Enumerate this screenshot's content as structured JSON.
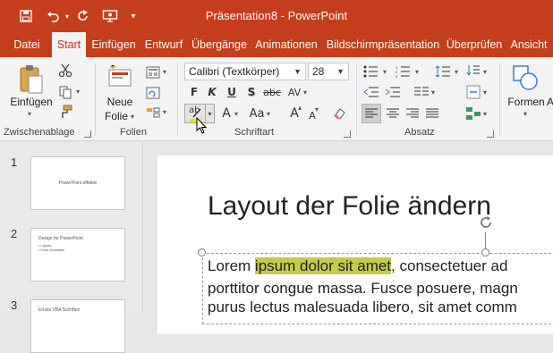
{
  "window": {
    "title": "Präsentation8 - PowerPoint"
  },
  "qat": {
    "save_icon": "save-icon",
    "undo_icon": "undo-icon",
    "redo_icon": "redo-icon",
    "present_icon": "present-from-start-icon",
    "customize_icon": "customize-qat-icon"
  },
  "tabs": [
    {
      "label": "Datei"
    },
    {
      "label": "Start"
    },
    {
      "label": "Einfügen"
    },
    {
      "label": "Entwurf"
    },
    {
      "label": "Übergänge"
    },
    {
      "label": "Animationen"
    },
    {
      "label": "Bildschirmpräsentation"
    },
    {
      "label": "Überprüfen"
    },
    {
      "label": "Ansicht"
    }
  ],
  "active_tab": "Start",
  "ribbon": {
    "clipboard": {
      "label": "Zwischenablage",
      "paste_label": "Einfügen"
    },
    "slides": {
      "label": "Folien",
      "new_slide_line1": "Neue",
      "new_slide_line2": "Folie"
    },
    "font": {
      "label": "Schriftart",
      "font_name": "Calibri (Textkörper)",
      "font_size": "28",
      "bold": "F",
      "italic": "K",
      "underline": "U",
      "shadow": "S",
      "strikethrough": "abc",
      "spacing": "AV",
      "highlight": "ab",
      "font_color": "A",
      "change_case": "Aa",
      "grow": "A",
      "shrink": "A"
    },
    "paragraph": {
      "label": "Absatz"
    },
    "drawing": {
      "label": "Formen",
      "label2": "A"
    }
  },
  "thumbnails": [
    {
      "number": "1",
      "text": "PowerPoint effektiv"
    },
    {
      "number": "2",
      "text_line1": "Design für PowerPoint",
      "text_line2": "• Layout",
      "text_line3": "• Folie einstellen"
    },
    {
      "number": "3",
      "text": "Ernsts VBA Schriften"
    }
  ],
  "slide": {
    "title": "Layout der Folie ändern",
    "body": {
      "line1_before": "Lorem ",
      "line1_highlight": "ipsum dolor sit amet",
      "line1_after": ", consectetuer ad",
      "line2": "porttitor congue massa. Fusce posuere, magn",
      "line3": "purus lectus malesuada libero, sit amet comm"
    }
  },
  "colors": {
    "brand": "#c43e1c",
    "highlight": "#c3cb4b",
    "ribbon_bg": "#f3f3f3"
  }
}
